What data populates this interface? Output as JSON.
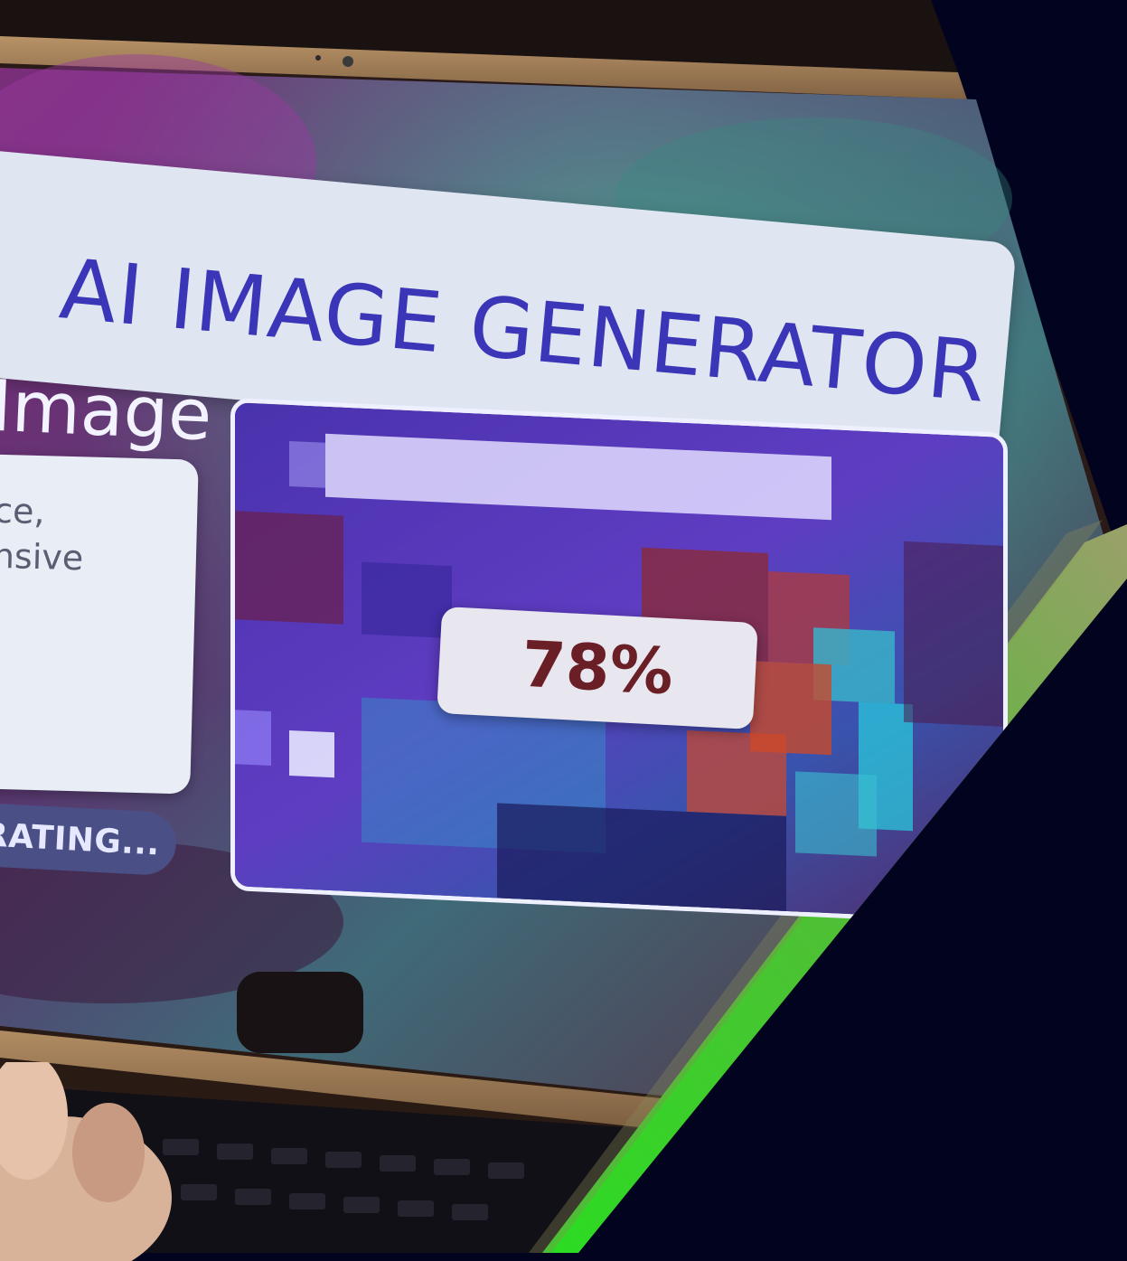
{
  "app": {
    "title": "AI IMAGE GENERATOR",
    "section_heading": "Image",
    "prompt_lines": [
      "ce,",
      "nsive"
    ],
    "generate_button_label": "NERATING...",
    "progress_label": "78%",
    "progress": 0.78
  },
  "colors": {
    "backdrop": "#02041f",
    "title_text": "#3b35b8",
    "title_bar": "#dfe6f2",
    "progress_text": "#6a1f27",
    "button": "#4a4f86",
    "accent_stripe": "#3ad12a"
  }
}
